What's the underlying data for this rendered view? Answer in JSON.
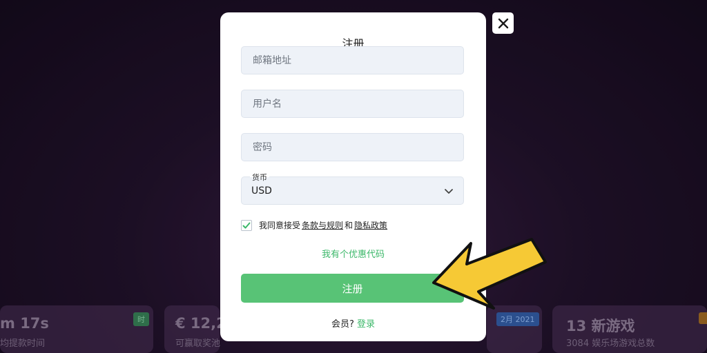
{
  "modal": {
    "title": "注册",
    "email_placeholder": "邮箱地址",
    "username_placeholder": "用户名",
    "password_placeholder": "密码",
    "currency_label": "货币",
    "currency_value": "USD",
    "agree_text": "我同意接受",
    "terms_link": "条款与规则",
    "and_text": "和",
    "privacy_link": "隐私政策",
    "promo_link": "我有个优惠代码",
    "submit_label": "注册",
    "member_text": "会员?",
    "login_link": "登录"
  },
  "background_cards": [
    {
      "big": "m 17s",
      "small": "均提款时间",
      "tag": "时"
    },
    {
      "big": "€ 12,2",
      "small": "可赢取奖池"
    },
    {
      "tag": "2月 2021"
    },
    {
      "big": "13 新游戏",
      "small": "3084 娱乐场游戏总数"
    }
  ],
  "colors": {
    "accent_green": "#58c376",
    "link_green": "#3cb86a",
    "arrow_yellow": "#f6c935"
  },
  "icons": {
    "close": "close-icon",
    "chevron": "chevron-down-icon",
    "check": "checkmark-icon",
    "arrow": "pointer-arrow-icon"
  }
}
